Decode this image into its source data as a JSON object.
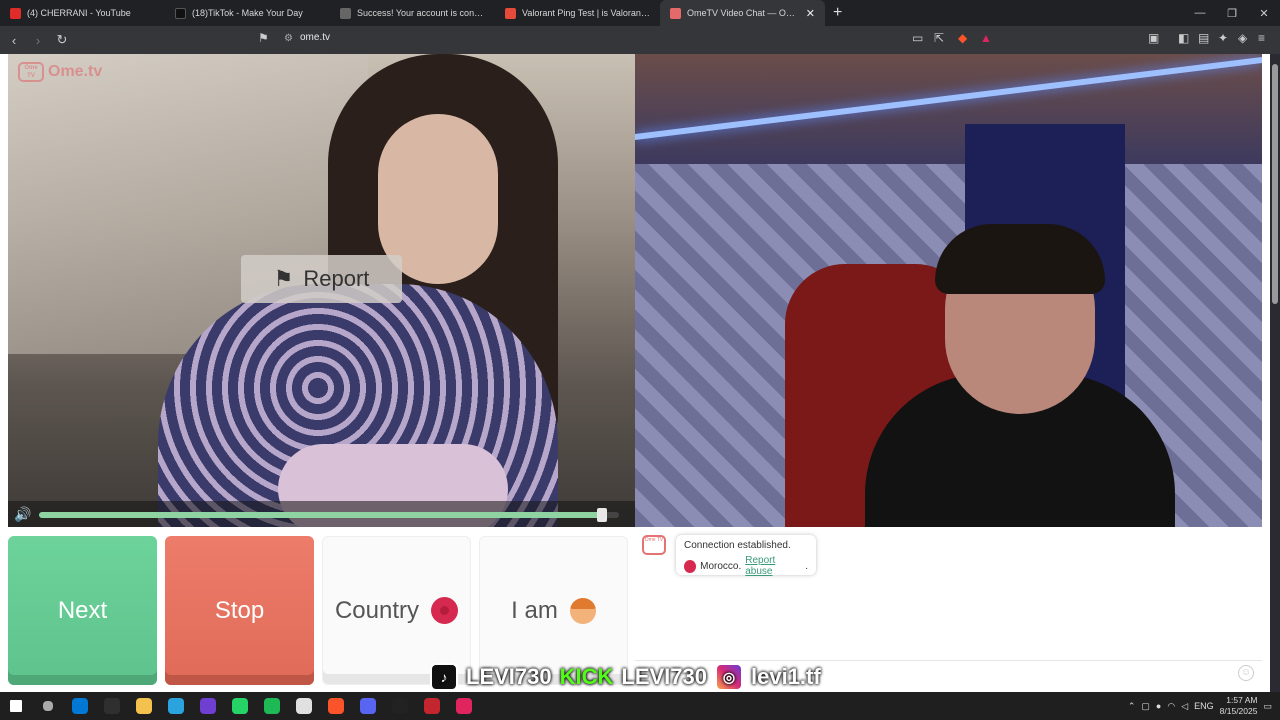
{
  "browser": {
    "tabs": [
      {
        "title": "(4) CHERRANI - YouTube",
        "color": "#e02b2b",
        "active": false
      },
      {
        "title": "(18)TikTok - Make Your Day",
        "color": "#111111",
        "active": false
      },
      {
        "title": "Success! Your account is connected",
        "color": "#666666",
        "active": false
      },
      {
        "title": "Valorant Ping Test | is Valorant down?",
        "color": "#e64a3a",
        "active": false
      },
      {
        "title": "OmeTV Video Chat — Omegle",
        "color": "#e46a6a",
        "active": true
      }
    ],
    "new_tab_label": "+",
    "url": "ome.tv"
  },
  "site": {
    "logo_text": "Ome.tv",
    "logo_badge": "Ome TV",
    "report_label": "Report",
    "volume_level": 0.97,
    "buttons": {
      "next": "Next",
      "stop": "Stop",
      "country": "Country",
      "iam": "I am"
    }
  },
  "chat": {
    "logo_badge": "Ome TV",
    "line1": "Connection established.",
    "country": "Morocco.",
    "report_link": "Report abuse",
    "period": "."
  },
  "overlay": {
    "tiktok": "LEVI730",
    "kick_label": "KICK",
    "kick": "LEVI730",
    "instagram": "levi1.tf"
  },
  "taskbar": {
    "lang": "ENG",
    "time": "1:57 AM",
    "date": "8/15/2025",
    "apps": [
      "#0078d4",
      "#2f2f2f",
      "#f2c14e",
      "#2aa3df",
      "#6f3fd1",
      "#25d366",
      "#1db954",
      "#e0e0e0",
      "#fb542b",
      "#5865f2",
      "#222222",
      "#c3262e",
      "#e0245e"
    ]
  },
  "colors": {
    "next": "#6cd39a",
    "stop": "#ed7c6a",
    "accent_link": "#3a9a7a",
    "flag": "#d6294f"
  }
}
